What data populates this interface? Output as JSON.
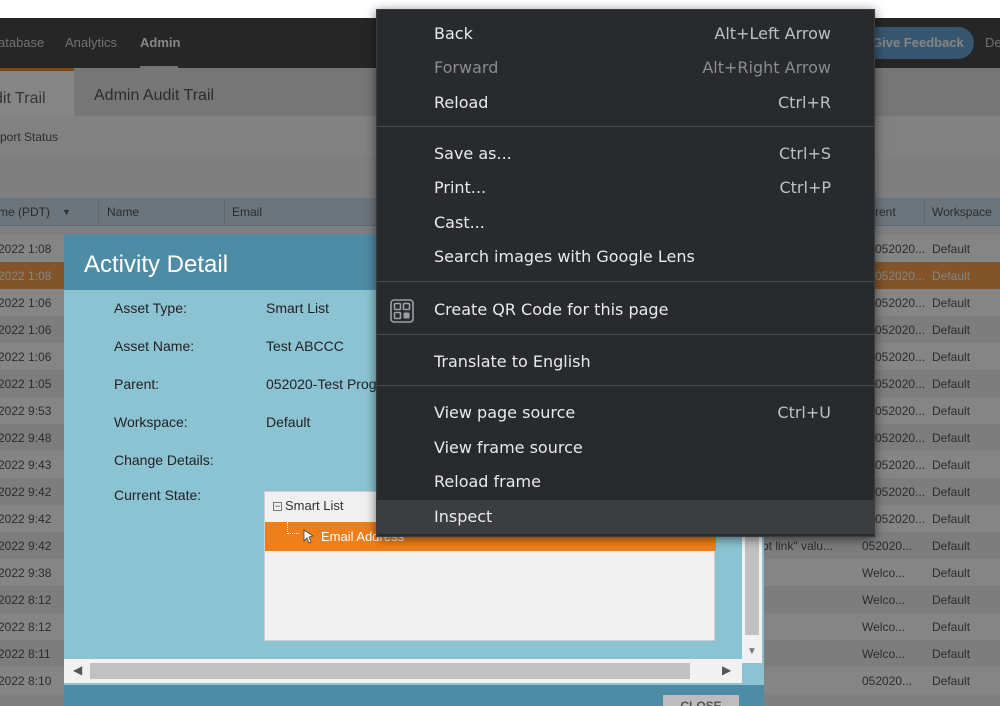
{
  "nav": {
    "items": [
      "atabase",
      "Analytics",
      "Admin"
    ],
    "feedback_label": "Give Feedback",
    "trailing": "De"
  },
  "tabs": {
    "selected": "dit Trail",
    "other": "Admin Audit Trail"
  },
  "sub_link": "port Status",
  "grid": {
    "headers": [
      "me (PDT)",
      "Name",
      "Email",
      "rent",
      "Workspace"
    ],
    "rows": [
      [
        "2022 1:08",
        "052020...",
        "Default"
      ],
      [
        "2022 1:08",
        "052020...",
        "Default"
      ],
      [
        "2022 1:06",
        "052020...",
        "Default"
      ],
      [
        "2022 1:06",
        "052020...",
        "Default"
      ],
      [
        "2022 1:06",
        "052020...",
        "Default"
      ],
      [
        "2022 1:05",
        "052020...",
        "Default"
      ],
      [
        "2022 9:53",
        "052020...",
        "Default"
      ],
      [
        "2022 9:48",
        "052020...",
        "Default"
      ],
      [
        "2022 9:43",
        "052020...",
        "Default"
      ],
      [
        "2022 9:42",
        "052020...",
        "Default"
      ],
      [
        "2022 9:42",
        "052020...",
        "Default"
      ],
      [
        "2022 9:42",
        "052020...",
        "Default"
      ],
      [
        "2022 9:38",
        "Welco...",
        "Default"
      ],
      [
        "2022 8:12",
        "Welco...",
        "Default"
      ],
      [
        "2022 8:12",
        "Welco...",
        "Default"
      ],
      [
        "2022 8:11",
        "Welco...",
        "Default"
      ],
      [
        "2022 8:10",
        "052020...",
        "Default"
      ]
    ],
    "partial_text": "pt link\" valu..."
  },
  "modal": {
    "title": "Activity Detail",
    "fields": [
      {
        "label": "Asset Type:",
        "value": "Smart List"
      },
      {
        "label": "Asset Name:",
        "value": "Test ABCCC"
      },
      {
        "label": "Parent:",
        "value": "052020-Test Prog"
      },
      {
        "label": "Workspace:",
        "value": "Default"
      },
      {
        "label": "Change Details:",
        "value": ""
      },
      {
        "label": "Current State:",
        "value": ""
      }
    ],
    "tree_root": "Smart List",
    "tree_child": "Email Address",
    "close_label": "CLOSE"
  },
  "context_menu": {
    "items": [
      {
        "label": "Back",
        "shortcut": "Alt+Left Arrow"
      },
      {
        "label": "Forward",
        "shortcut": "Alt+Right Arrow",
        "disabled": true
      },
      {
        "label": "Reload",
        "shortcut": "Ctrl+R"
      },
      {
        "label": "Save as...",
        "shortcut": "Ctrl+S"
      },
      {
        "label": "Print...",
        "shortcut": "Ctrl+P"
      },
      {
        "label": "Cast...",
        "shortcut": ""
      },
      {
        "label": "Search images with Google Lens",
        "shortcut": ""
      },
      {
        "label": "Create QR Code for this page",
        "shortcut": "",
        "icon": "qr-code-icon"
      },
      {
        "label": "Translate to English",
        "shortcut": ""
      },
      {
        "label": "View page source",
        "shortcut": "Ctrl+U"
      },
      {
        "label": "View frame source",
        "shortcut": ""
      },
      {
        "label": "Reload frame",
        "shortcut": ""
      },
      {
        "label": "Inspect",
        "shortcut": "",
        "hovered": true
      }
    ]
  },
  "colors": {
    "accent_orange": "#ef7f1a",
    "modal_header": "#4e8ca5",
    "modal_body": "#8cc3d3",
    "menu_bg": "#292a2d"
  }
}
